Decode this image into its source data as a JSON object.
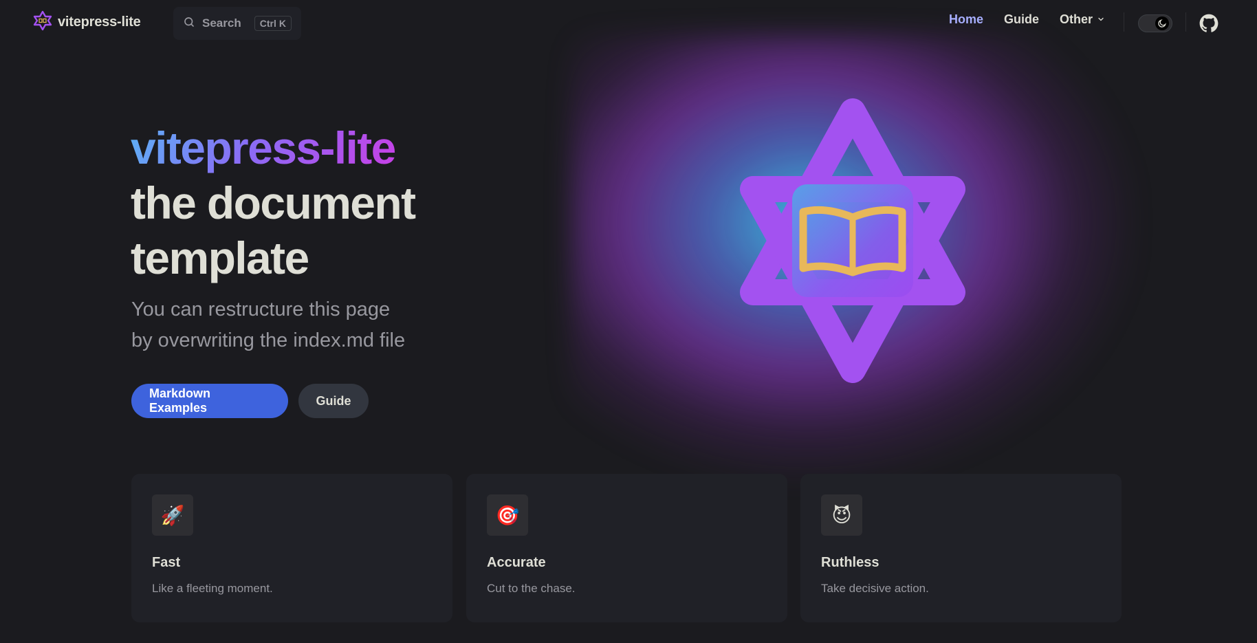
{
  "nav": {
    "title": "vitepress-lite",
    "search": {
      "label": "Search",
      "kbd_ctrl": "Ctrl",
      "kbd_key": "K"
    },
    "links": [
      {
        "label": "Home",
        "active": true
      },
      {
        "label": "Guide",
        "active": false
      },
      {
        "label": "Other",
        "active": false,
        "dropdown": true
      }
    ],
    "appearance_toggle": {
      "mode": "dark",
      "icon": "moon-icon"
    },
    "social": {
      "icon": "github-icon"
    }
  },
  "hero": {
    "name": "vitepress-lite",
    "text": "the document template",
    "tagline_line1": "You can restructure this page",
    "tagline_line2": "by overwriting the index.md file",
    "actions": [
      {
        "label": "Markdown Examples",
        "theme": "brand"
      },
      {
        "label": "Guide",
        "theme": "alt"
      }
    ],
    "image": {
      "icon": "star-of-david-book-logo"
    }
  },
  "features": [
    {
      "icon": "🚀",
      "title": "Fast",
      "details": "Like a fleeting moment."
    },
    {
      "icon": "🎯",
      "title": "Accurate",
      "details": "Cut to the chase."
    },
    {
      "icon": "😈",
      "title": "Ruthless",
      "details": "Take decisive action."
    }
  ],
  "colors": {
    "background": "#1b1b1f",
    "brand": "#3e63dd",
    "active_link": "#a8b1ff",
    "logo_purple": "#a352f0",
    "book_gold": "#e8b85a"
  }
}
